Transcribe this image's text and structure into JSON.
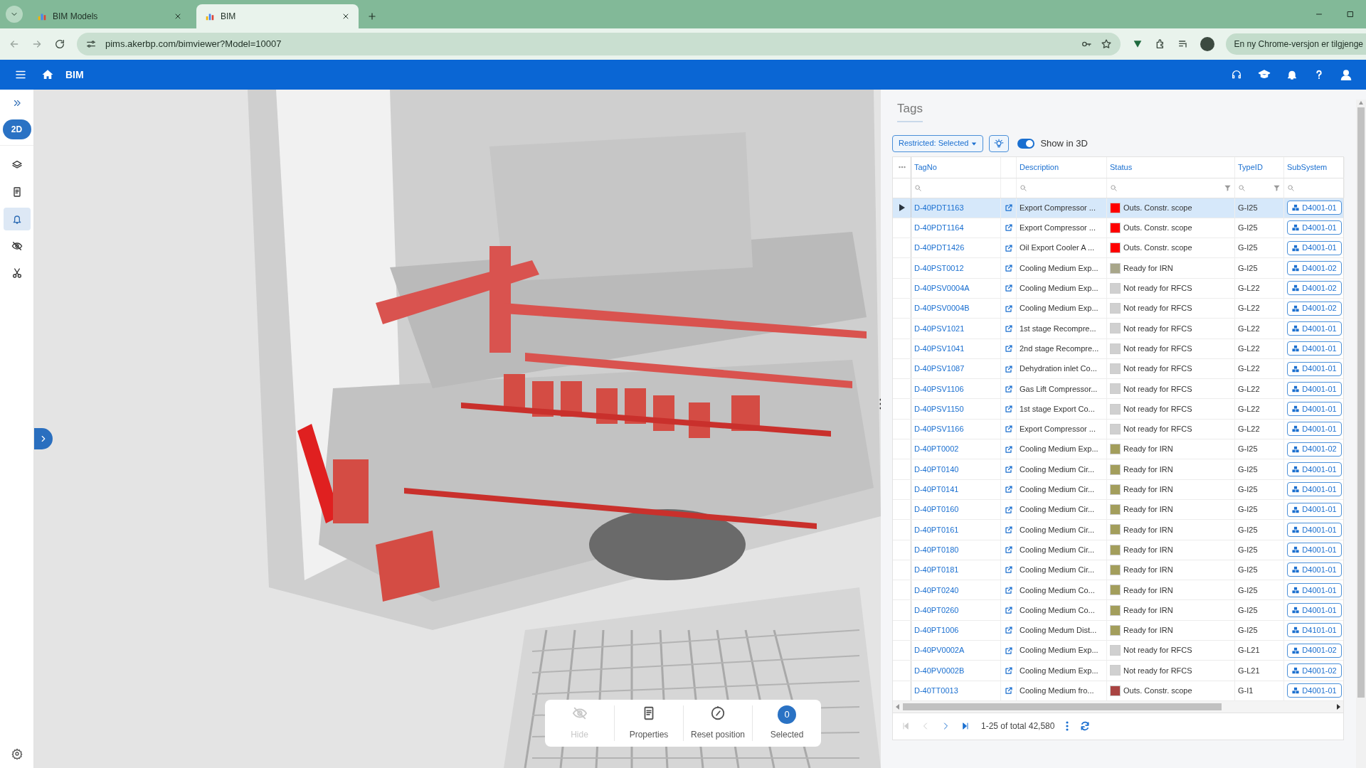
{
  "browser": {
    "tabs": [
      {
        "title": "BIM Models",
        "selected": false
      },
      {
        "title": "BIM",
        "selected": true
      }
    ],
    "url": "pims.akerbp.com/bimviewer?Model=10007",
    "update_notice": "En ny Chrome-versjon er tilgjenge"
  },
  "app_header": {
    "title": "BIM"
  },
  "sidebar": {
    "mode_button": "2D",
    "items": [
      {
        "kind": "layers",
        "selected": false
      },
      {
        "kind": "document",
        "selected": false
      },
      {
        "kind": "bell",
        "selected": true
      },
      {
        "kind": "hidden",
        "selected": false
      },
      {
        "kind": "cut",
        "selected": false
      }
    ]
  },
  "tags_panel": {
    "title": "Tags",
    "filter_dropdown": "Restricted: Selected",
    "show_in_3d": {
      "label": "Show in 3D",
      "on": true
    },
    "table": {
      "columns": [
        "TagNo",
        "Description",
        "Status",
        "TypeID",
        "SubSystem"
      ],
      "rows": [
        {
          "tag": "D-40PDT1163",
          "description": "Export Compressor ...",
          "status": "Outs. Constr. scope",
          "color": "#ff0000",
          "type_id": "G-I25",
          "subsystem": "D4001-01",
          "selected": true
        },
        {
          "tag": "D-40PDT1164",
          "description": "Export Compressor ...",
          "status": "Outs. Constr. scope",
          "color": "#ff0000",
          "type_id": "G-I25",
          "subsystem": "D4001-01",
          "selected": false
        },
        {
          "tag": "D-40PDT1426",
          "description": "Oil Export Cooler A ...",
          "status": "Outs. Constr. scope",
          "color": "#ff0000",
          "type_id": "G-I25",
          "subsystem": "D4001-01",
          "selected": false
        },
        {
          "tag": "D-40PST0012",
          "description": "Cooling Medium Exp...",
          "status": "Ready for IRN",
          "color": "#a8a68a",
          "type_id": "G-I25",
          "subsystem": "D4001-02",
          "selected": false
        },
        {
          "tag": "D-40PSV0004A",
          "description": "Cooling Medium Exp...",
          "status": "Not ready for RFCS",
          "color": "#d0d0d0",
          "type_id": "G-L22",
          "subsystem": "D4001-02",
          "selected": false
        },
        {
          "tag": "D-40PSV0004B",
          "description": "Cooling Medium Exp...",
          "status": "Not ready for RFCS",
          "color": "#d0d0d0",
          "type_id": "G-L22",
          "subsystem": "D4001-02",
          "selected": false
        },
        {
          "tag": "D-40PSV1021",
          "description": "1st stage Recompre...",
          "status": "Not ready for RFCS",
          "color": "#d0d0d0",
          "type_id": "G-L22",
          "subsystem": "D4001-01",
          "selected": false
        },
        {
          "tag": "D-40PSV1041",
          "description": "2nd stage Recompre...",
          "status": "Not ready for RFCS",
          "color": "#d0d0d0",
          "type_id": "G-L22",
          "subsystem": "D4001-01",
          "selected": false
        },
        {
          "tag": "D-40PSV1087",
          "description": "Dehydration inlet Co...",
          "status": "Not ready for RFCS",
          "color": "#d0d0d0",
          "type_id": "G-L22",
          "subsystem": "D4001-01",
          "selected": false
        },
        {
          "tag": "D-40PSV1106",
          "description": "Gas Lift Compressor...",
          "status": "Not ready for RFCS",
          "color": "#d0d0d0",
          "type_id": "G-L22",
          "subsystem": "D4001-01",
          "selected": false
        },
        {
          "tag": "D-40PSV1150",
          "description": "1st stage Export Co...",
          "status": "Not ready for RFCS",
          "color": "#d0d0d0",
          "type_id": "G-L22",
          "subsystem": "D4001-01",
          "selected": false
        },
        {
          "tag": "D-40PSV1166",
          "description": "Export Compressor ...",
          "status": "Not ready for RFCS",
          "color": "#d0d0d0",
          "type_id": "G-L22",
          "subsystem": "D4001-01",
          "selected": false
        },
        {
          "tag": "D-40PT0002",
          "description": "Cooling Medium Exp...",
          "status": "Ready for IRN",
          "color": "#a39e5c",
          "type_id": "G-I25",
          "subsystem": "D4001-02",
          "selected": false
        },
        {
          "tag": "D-40PT0140",
          "description": "Cooling Medium Cir...",
          "status": "Ready for IRN",
          "color": "#a39e5c",
          "type_id": "G-I25",
          "subsystem": "D4001-01",
          "selected": false
        },
        {
          "tag": "D-40PT0141",
          "description": "Cooling Medium Cir...",
          "status": "Ready for IRN",
          "color": "#a39e5c",
          "type_id": "G-I25",
          "subsystem": "D4001-01",
          "selected": false
        },
        {
          "tag": "D-40PT0160",
          "description": "Cooling Medium Cir...",
          "status": "Ready for IRN",
          "color": "#a39e5c",
          "type_id": "G-I25",
          "subsystem": "D4001-01",
          "selected": false
        },
        {
          "tag": "D-40PT0161",
          "description": "Cooling Medium Cir...",
          "status": "Ready for IRN",
          "color": "#a39e5c",
          "type_id": "G-I25",
          "subsystem": "D4001-01",
          "selected": false
        },
        {
          "tag": "D-40PT0180",
          "description": "Cooling Medium Cir...",
          "status": "Ready for IRN",
          "color": "#a39e5c",
          "type_id": "G-I25",
          "subsystem": "D4001-01",
          "selected": false
        },
        {
          "tag": "D-40PT0181",
          "description": "Cooling Medium Cir...",
          "status": "Ready for IRN",
          "color": "#a39e5c",
          "type_id": "G-I25",
          "subsystem": "D4001-01",
          "selected": false
        },
        {
          "tag": "D-40PT0240",
          "description": "Cooling Medium Co...",
          "status": "Ready for IRN",
          "color": "#a39e5c",
          "type_id": "G-I25",
          "subsystem": "D4001-01",
          "selected": false
        },
        {
          "tag": "D-40PT0260",
          "description": "Cooling Medium Co...",
          "status": "Ready for IRN",
          "color": "#a39e5c",
          "type_id": "G-I25",
          "subsystem": "D4001-01",
          "selected": false
        },
        {
          "tag": "D-40PT1006",
          "description": "Cooling Medum Dist...",
          "status": "Ready for IRN",
          "color": "#a39e5c",
          "type_id": "G-I25",
          "subsystem": "D4101-01",
          "selected": false
        },
        {
          "tag": "D-40PV0002A",
          "description": "Cooling Medium Exp...",
          "status": "Not ready for RFCS",
          "color": "#d0d0d0",
          "type_id": "G-L21",
          "subsystem": "D4001-02",
          "selected": false
        },
        {
          "tag": "D-40PV0002B",
          "description": "Cooling Medium Exp...",
          "status": "Not ready for RFCS",
          "color": "#d0d0d0",
          "type_id": "G-L21",
          "subsystem": "D4001-02",
          "selected": false
        },
        {
          "tag": "D-40TT0013",
          "description": "Cooling Medium fro...",
          "status": "Outs. Constr. scope",
          "color": "#a94442",
          "type_id": "G-I1",
          "subsystem": "D4001-01",
          "selected": false
        }
      ]
    },
    "pager": {
      "summary": "1-25 of total 42,580"
    }
  },
  "viewer_toolbar": {
    "buttons": [
      {
        "kind": "hide",
        "label": "Hide",
        "disabled": true
      },
      {
        "kind": "properties",
        "label": "Properties",
        "disabled": false
      },
      {
        "kind": "reset",
        "label": "Reset position",
        "disabled": false
      },
      {
        "kind": "selected",
        "label": "Selected",
        "count": "0",
        "disabled": false
      }
    ]
  }
}
